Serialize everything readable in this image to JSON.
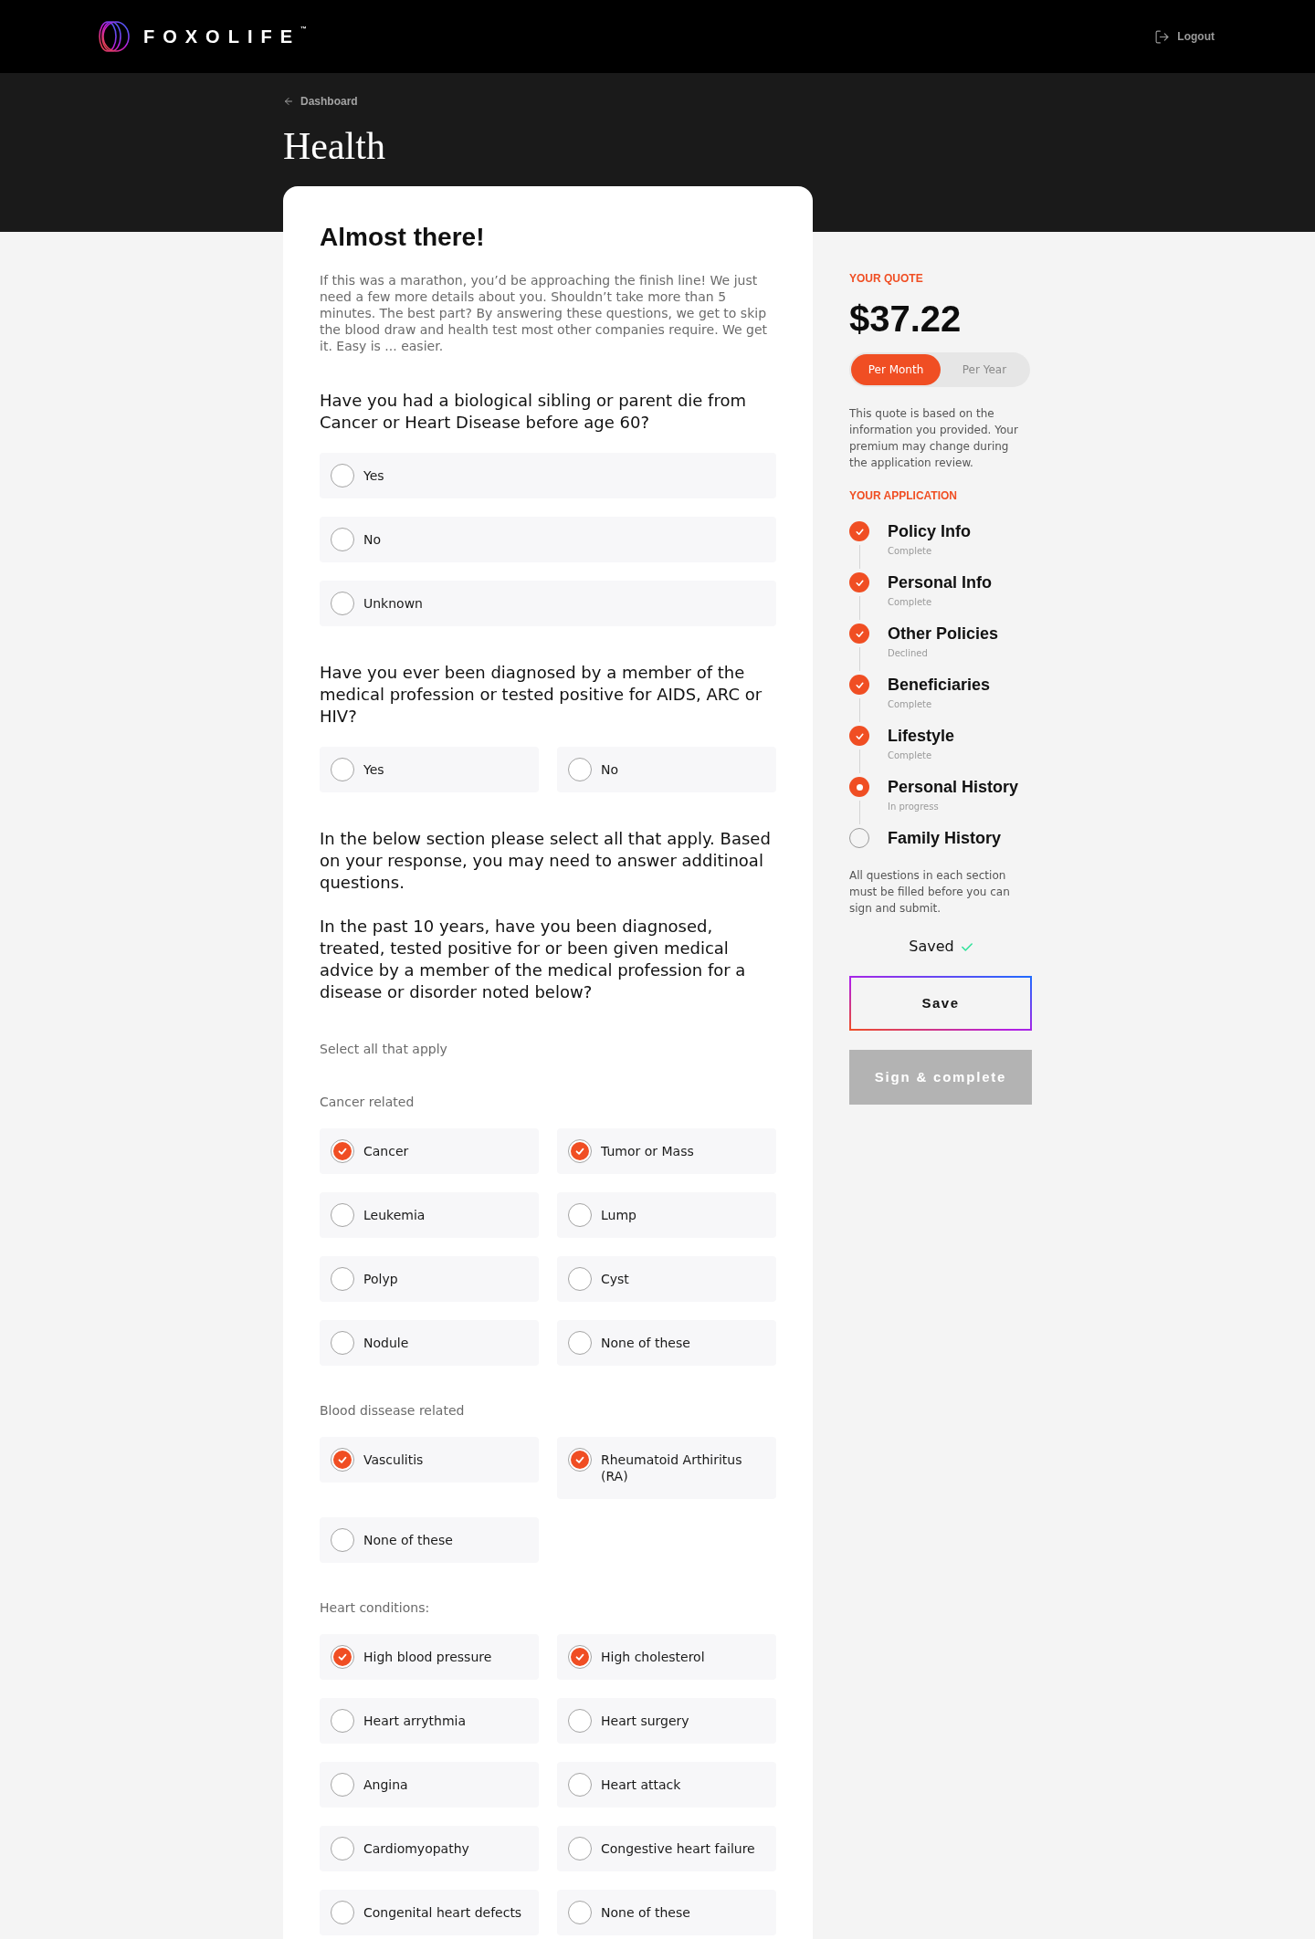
{
  "header": {
    "brand": "FOXOLIFE$^{™}$",
    "logout": "Logout"
  },
  "banner": {
    "back_link": "Dashboard",
    "title": "Health"
  },
  "form": {
    "title": "Almost there!",
    "intro": "If this was a marathon, you’d be approaching the finish line! We just need a few more details about you. Shouldn’t take more than 5 minutes. The best part? By answering these questions, we get to skip the blood draw and health test most other companies require. We get it. Easy is ... easier.",
    "questions": [
      {
        "text": "Have you had a biological sibling or parent die from Cancer or Heart Disease before age 60?",
        "options": [
          {
            "label": "Yes",
            "selected": false
          },
          {
            "label": "No",
            "selected": false
          },
          {
            "label": "Unknown",
            "selected": false
          }
        ]
      },
      {
        "text": "Have you ever been diagnosed by a member of the medical profession or tested positive for AIDS, ARC or HIV?",
        "options": [
          {
            "label": "Yes",
            "selected": false
          },
          {
            "label": "No",
            "selected": false
          }
        ]
      }
    ],
    "checklist": {
      "instructions": [
        "In the below section please select all that apply. Based on your response, you may need to answer additinoal questions.",
        "In the past 10 years, have you been diagnosed, treated, tested positive for or been given medical advice by a member of the medical profession for a disease or disorder noted below?"
      ],
      "hint": "Select all that apply",
      "groups": [
        {
          "title": "Cancer related",
          "options": [
            {
              "label": "Cancer",
              "checked": true
            },
            {
              "label": "Tumor or Mass",
              "checked": true
            },
            {
              "label": "Leukemia",
              "checked": false
            },
            {
              "label": "Lump",
              "checked": false
            },
            {
              "label": "Polyp",
              "checked": false
            },
            {
              "label": "Cyst",
              "checked": false
            },
            {
              "label": "Nodule",
              "checked": false
            },
            {
              "label": "None of these",
              "checked": false
            }
          ]
        },
        {
          "title": "Blood dissease related",
          "options": [
            {
              "label": "Vasculitis",
              "checked": true
            },
            {
              "label": "Rheumatoid Arthiritus (RA)",
              "checked": true
            },
            {
              "label": "None of these",
              "checked": false
            }
          ]
        },
        {
          "title": "Heart conditions:",
          "options": [
            {
              "label": "High blood pressure",
              "checked": true
            },
            {
              "label": "High cholesterol",
              "checked": true
            },
            {
              "label": "Heart arrythmia",
              "checked": false
            },
            {
              "label": "Heart surgery",
              "checked": false
            },
            {
              "label": "Angina",
              "checked": false
            },
            {
              "label": "Heart attack",
              "checked": false
            },
            {
              "label": "Cardiomyopathy",
              "checked": false
            },
            {
              "label": "Congestive heart failure",
              "checked": false
            },
            {
              "label": "Congenital heart defects",
              "checked": false
            },
            {
              "label": "None of these",
              "checked": false
            }
          ]
        }
      ]
    }
  },
  "quote": {
    "heading": "YOUR QUOTE",
    "amount": "$37.22",
    "periods": [
      {
        "label": "Per Month",
        "selected": true
      },
      {
        "label": "Per Year",
        "selected": false
      }
    ],
    "note": "This quote is based on the information you provided. Your premium may change during the application review."
  },
  "application": {
    "heading": "YOUR APPLICATION",
    "steps": [
      {
        "title": "Policy Info",
        "status": "Complete",
        "kind": "done"
      },
      {
        "title": "Personal Info",
        "status": "Complete",
        "kind": "done"
      },
      {
        "title": "Other Policies",
        "status": "Declined",
        "kind": "done"
      },
      {
        "title": "Beneficiaries",
        "status": "Complete",
        "kind": "done"
      },
      {
        "title": "Lifestyle",
        "status": "Complete",
        "kind": "done"
      },
      {
        "title": "Personal History",
        "status": "In progress",
        "kind": "current"
      },
      {
        "title": "Family History",
        "kind": "pending"
      }
    ],
    "note": "All questions in each section must be filled before you can sign and submit."
  },
  "save_status": "Saved",
  "save_button": "Save",
  "submit_button": {
    "label": "Sign & complete",
    "disabled": true
  }
}
